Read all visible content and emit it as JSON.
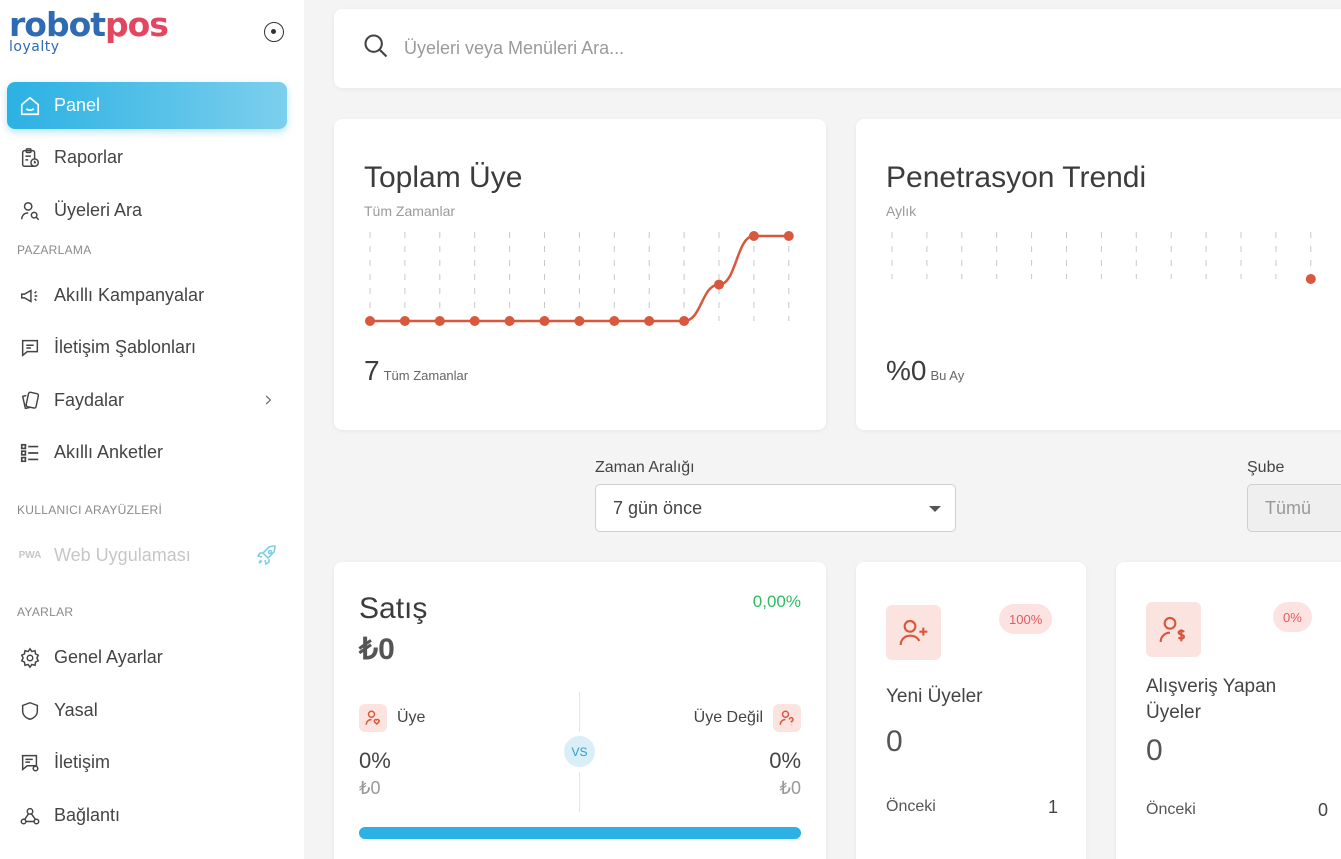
{
  "brand": {
    "name_part1": "robot",
    "name_part2": "pos",
    "sub": "loyalty"
  },
  "sidebar": {
    "items": [
      {
        "label": "Panel"
      },
      {
        "label": "Raporlar"
      },
      {
        "label": "Üyeleri Ara"
      },
      {
        "label": "Akıllı Kampanyalar"
      },
      {
        "label": "İletişim Şablonları"
      },
      {
        "label": "Faydalar"
      },
      {
        "label": "Akıllı Anketler"
      },
      {
        "label": "Web Uygulaması",
        "prefix": "PWA"
      },
      {
        "label": "Genel Ayarlar"
      },
      {
        "label": "Yasal"
      },
      {
        "label": "İletişim"
      },
      {
        "label": "Bağlantı"
      }
    ],
    "sections": {
      "marketing": "PAZARLAMA",
      "ui": "KULLANICI ARAYÜZLERİ",
      "settings": "AYARLAR"
    }
  },
  "search": {
    "placeholder": "Üyeleri veya Menüleri Ara..."
  },
  "total_members": {
    "title": "Toplam Üye",
    "subtitle": "Tüm Zamanlar",
    "value": "7",
    "value_label": "Tüm Zamanlar"
  },
  "penetration": {
    "title": "Penetrasyon Trendi",
    "subtitle": "Aylık",
    "value": "%0",
    "value_label": "Bu Ay"
  },
  "filters": {
    "time_label": "Zaman Aralığı",
    "time_value": "7 gün önce",
    "branch_label": "Şube",
    "branch_value": "Tümü"
  },
  "sales": {
    "title": "Satış",
    "amount": "₺0",
    "change": "0,00%",
    "member_label": "Üye",
    "nonmember_label": "Üye Değil",
    "member_pct": "0%",
    "member_amount": "₺0",
    "nonmember_pct": "0%",
    "nonmember_amount": "₺0",
    "vs": "VS",
    "member_share": 1.0
  },
  "new_members": {
    "badge": "100%",
    "title": "Yeni Üyeler",
    "value": "0",
    "prev_label": "Önceki",
    "prev_value": "1"
  },
  "shopping_members": {
    "badge": "0%",
    "title": "Alışveriş Yapan Üyeler",
    "value": "0",
    "prev_label": "Önceki",
    "prev_value": "0"
  },
  "chart_data": [
    {
      "type": "line",
      "x": [
        1,
        2,
        3,
        4,
        5,
        6,
        7,
        8,
        9,
        10,
        11,
        12,
        13
      ],
      "series": [
        {
          "values": [
            0,
            0,
            0,
            0,
            0,
            0,
            0,
            0,
            0,
            0,
            3,
            7,
            7
          ]
        }
      ],
      "color": "#d9573c",
      "grid": "vertical-dashed"
    },
    {
      "type": "line",
      "x": [
        1,
        2,
        3,
        4,
        5,
        6,
        7,
        8,
        9,
        10,
        11,
        12,
        13
      ],
      "series": [
        {
          "values": [
            null,
            null,
            null,
            null,
            null,
            null,
            null,
            null,
            null,
            null,
            null,
            null,
            0
          ]
        }
      ],
      "color": "#d9573c",
      "grid": "vertical-dashed"
    }
  ]
}
